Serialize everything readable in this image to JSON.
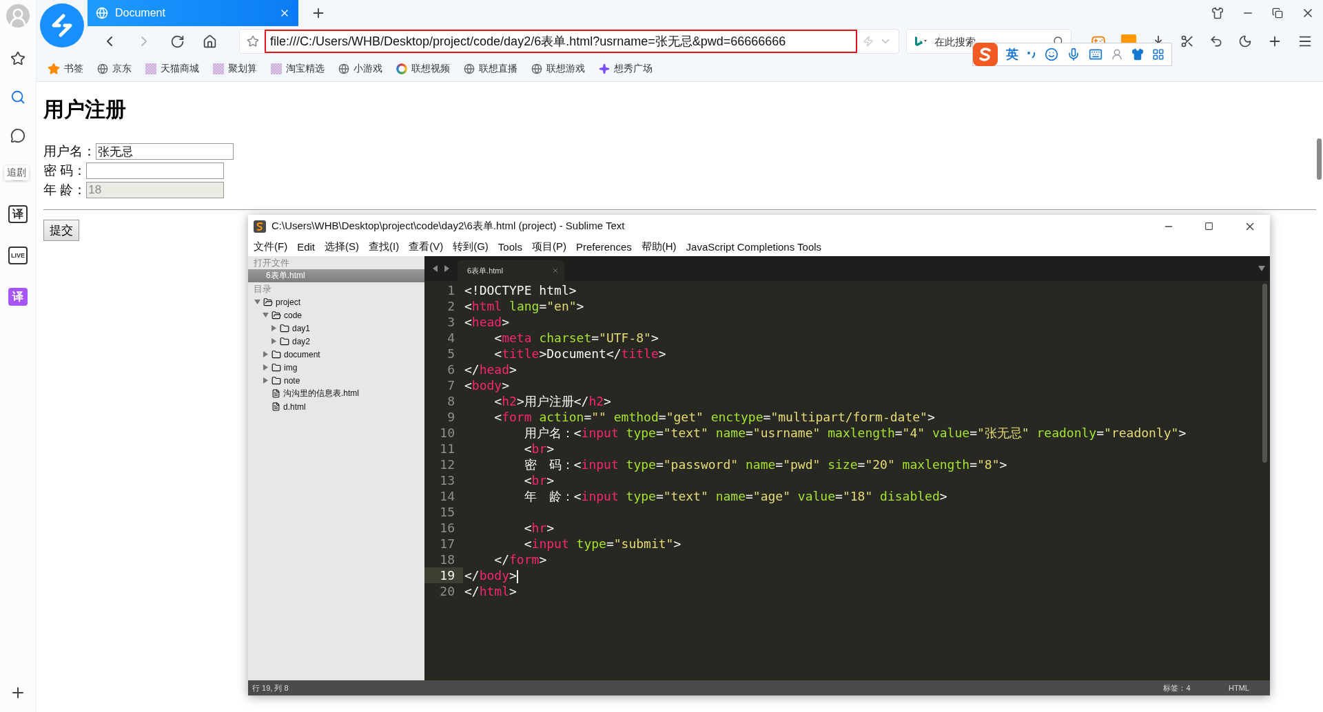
{
  "rail": {
    "tooltip": "追剧",
    "items": [
      {
        "kind": "star"
      },
      {
        "kind": "search"
      },
      {
        "kind": "chat"
      },
      {
        "kind": "video"
      },
      {
        "kind": "glyph",
        "text": "译"
      },
      {
        "kind": "glyph",
        "text": "LIVE"
      },
      {
        "kind": "filled",
        "text": "译"
      }
    ]
  },
  "browser": {
    "tab": {
      "title": "Document",
      "selected": true
    },
    "address": "file:///C:/Users/WHB/Desktop/project/code/day2/6表单.html?usrname=张无忌&pwd=66666666",
    "search_placeholder": "在此搜索",
    "ime_mode": "英",
    "bookmarks": [
      {
        "label": "书签",
        "kind": "star"
      },
      {
        "label": "京东",
        "kind": "globe"
      },
      {
        "label": "天猫商城",
        "kind": "pixel"
      },
      {
        "label": "聚划算",
        "kind": "pixel"
      },
      {
        "label": "淘宝精选",
        "kind": "pixel"
      },
      {
        "label": "小游戏",
        "kind": "globe"
      },
      {
        "label": "联想视频",
        "kind": "ring"
      },
      {
        "label": "联想直播",
        "kind": "globe"
      },
      {
        "label": "联想游戏",
        "kind": "globe"
      },
      {
        "label": "想秀广场",
        "kind": "sparkle"
      }
    ]
  },
  "page": {
    "heading": "用户注册",
    "fields": [
      {
        "label": "用户名：",
        "kind": "text",
        "value": "张无忌",
        "disabled": false
      },
      {
        "label": "密 码：",
        "kind": "password",
        "disabled": false
      },
      {
        "label": "年 龄：",
        "kind": "text",
        "value": "18",
        "disabled": true
      }
    ],
    "submit": "提交"
  },
  "editor": {
    "title": "C:\\Users\\WHB\\Desktop\\project\\code\\day2\\6表单.html (project) - Sublime Text",
    "menu": [
      "文件(F)",
      "Edit",
      "选择(S)",
      "查找(I)",
      "查看(V)",
      "转到(G)",
      "Tools",
      "项目(P)",
      "Preferences",
      "帮助(H)",
      "JavaScript Completions Tools"
    ],
    "open_files_heading": "打开文件",
    "open_files": [
      {
        "name": "6表单.html",
        "selected": true
      }
    ],
    "folders_heading": "目录",
    "tree": [
      {
        "name": "project",
        "kind": "folder",
        "expanded": true,
        "children": [
          {
            "name": "code",
            "kind": "folder",
            "expanded": true,
            "children": [
              {
                "name": "day1",
                "kind": "folder",
                "expanded": false
              },
              {
                "name": "day2",
                "kind": "folder",
                "expanded": false
              }
            ]
          },
          {
            "name": "document",
            "kind": "folder",
            "expanded": false
          },
          {
            "name": "img",
            "kind": "folder",
            "expanded": false
          },
          {
            "name": "note",
            "kind": "folder",
            "expanded": false
          },
          {
            "name": "沟沟里的信息表.html",
            "kind": "file"
          },
          {
            "name": "d.html",
            "kind": "file"
          }
        ]
      }
    ],
    "tabs": [
      {
        "label": "6表单.html",
        "selected": true
      }
    ],
    "lines": [
      {
        "number": "1",
        "current": false,
        "tokens": [
          {
            "kind": "plain",
            "text": "<!DOCTYPE html>"
          }
        ]
      },
      {
        "number": "2",
        "current": false,
        "tokens": [
          {
            "kind": "plain",
            "text": "<"
          },
          {
            "kind": "tag",
            "text": "html"
          },
          {
            "kind": "attr",
            "text": " lang"
          },
          {
            "kind": "plain",
            "text": "="
          },
          {
            "kind": "str",
            "text": "\"en\""
          },
          {
            "kind": "plain",
            "text": ">"
          }
        ]
      },
      {
        "number": "3",
        "current": false,
        "tokens": [
          {
            "kind": "plain",
            "text": "<"
          },
          {
            "kind": "tag",
            "text": "head"
          },
          {
            "kind": "plain",
            "text": ">"
          }
        ]
      },
      {
        "number": "4",
        "current": false,
        "tokens": [
          {
            "kind": "plain",
            "text": "    <"
          },
          {
            "kind": "tag",
            "text": "meta"
          },
          {
            "kind": "attr",
            "text": " charset"
          },
          {
            "kind": "plain",
            "text": "="
          },
          {
            "kind": "str",
            "text": "\"UTF-8\""
          },
          {
            "kind": "plain",
            "text": ">"
          }
        ]
      },
      {
        "number": "5",
        "current": false,
        "tokens": [
          {
            "kind": "plain",
            "text": "    <"
          },
          {
            "kind": "tag",
            "text": "title"
          },
          {
            "kind": "plain",
            "text": ">Document</"
          },
          {
            "kind": "tag",
            "text": "title"
          },
          {
            "kind": "plain",
            "text": ">"
          }
        ]
      },
      {
        "number": "6",
        "current": false,
        "tokens": [
          {
            "kind": "plain",
            "text": "</"
          },
          {
            "kind": "tag",
            "text": "head"
          },
          {
            "kind": "plain",
            "text": ">"
          }
        ]
      },
      {
        "number": "7",
        "current": false,
        "tokens": [
          {
            "kind": "plain",
            "text": "<"
          },
          {
            "kind": "tag",
            "text": "body"
          },
          {
            "kind": "plain",
            "text": ">"
          }
        ]
      },
      {
        "number": "8",
        "current": false,
        "tokens": [
          {
            "kind": "plain",
            "text": "    <"
          },
          {
            "kind": "tag",
            "text": "h2"
          },
          {
            "kind": "plain",
            "text": ">用户注册</"
          },
          {
            "kind": "tag",
            "text": "h2"
          },
          {
            "kind": "plain",
            "text": ">"
          }
        ]
      },
      {
        "number": "9",
        "current": false,
        "tokens": [
          {
            "kind": "plain",
            "text": "    <"
          },
          {
            "kind": "tag",
            "text": "form"
          },
          {
            "kind": "attr",
            "text": " action"
          },
          {
            "kind": "plain",
            "text": "="
          },
          {
            "kind": "str",
            "text": "\"\""
          },
          {
            "kind": "attr",
            "text": " emthod"
          },
          {
            "kind": "plain",
            "text": "="
          },
          {
            "kind": "str",
            "text": "\"get\""
          },
          {
            "kind": "attr",
            "text": " enctype"
          },
          {
            "kind": "plain",
            "text": "="
          },
          {
            "kind": "str",
            "text": "\"multipart/form-date\""
          },
          {
            "kind": "plain",
            "text": ">"
          }
        ]
      },
      {
        "number": "10",
        "current": false,
        "tokens": [
          {
            "kind": "plain",
            "text": "        用户名：<"
          },
          {
            "kind": "tag",
            "text": "input"
          },
          {
            "kind": "attr",
            "text": " type"
          },
          {
            "kind": "plain",
            "text": "="
          },
          {
            "kind": "str",
            "text": "\"text\""
          },
          {
            "kind": "attr",
            "text": " name"
          },
          {
            "kind": "plain",
            "text": "="
          },
          {
            "kind": "str",
            "text": "\"usrname\""
          },
          {
            "kind": "attr",
            "text": " maxlength"
          },
          {
            "kind": "plain",
            "text": "="
          },
          {
            "kind": "str",
            "text": "\"4\""
          },
          {
            "kind": "attr",
            "text": " value"
          },
          {
            "kind": "plain",
            "text": "="
          },
          {
            "kind": "str",
            "text": "\"张无忌\""
          },
          {
            "kind": "attr",
            "text": " readonly"
          },
          {
            "kind": "plain",
            "text": "="
          },
          {
            "kind": "str",
            "text": "\"readonly\""
          },
          {
            "kind": "plain",
            "text": ">"
          }
        ]
      },
      {
        "number": "11",
        "current": false,
        "tokens": [
          {
            "kind": "plain",
            "text": "        <"
          },
          {
            "kind": "tag",
            "text": "br"
          },
          {
            "kind": "plain",
            "text": ">"
          }
        ]
      },
      {
        "number": "12",
        "current": false,
        "tokens": [
          {
            "kind": "plain",
            "text": "        密　码：<"
          },
          {
            "kind": "tag",
            "text": "input"
          },
          {
            "kind": "attr",
            "text": " type"
          },
          {
            "kind": "plain",
            "text": "="
          },
          {
            "kind": "str",
            "text": "\"password\""
          },
          {
            "kind": "attr",
            "text": " name"
          },
          {
            "kind": "plain",
            "text": "="
          },
          {
            "kind": "str",
            "text": "\"pwd\""
          },
          {
            "kind": "attr",
            "text": " size"
          },
          {
            "kind": "plain",
            "text": "="
          },
          {
            "kind": "str",
            "text": "\"20\""
          },
          {
            "kind": "attr",
            "text": " maxlength"
          },
          {
            "kind": "plain",
            "text": "="
          },
          {
            "kind": "str",
            "text": "\"8\""
          },
          {
            "kind": "plain",
            "text": ">"
          }
        ]
      },
      {
        "number": "13",
        "current": false,
        "tokens": [
          {
            "kind": "plain",
            "text": "        <"
          },
          {
            "kind": "tag",
            "text": "br"
          },
          {
            "kind": "plain",
            "text": ">"
          }
        ]
      },
      {
        "number": "14",
        "current": false,
        "tokens": [
          {
            "kind": "plain",
            "text": "        年　龄：<"
          },
          {
            "kind": "tag",
            "text": "input"
          },
          {
            "kind": "attr",
            "text": " type"
          },
          {
            "kind": "plain",
            "text": "="
          },
          {
            "kind": "str",
            "text": "\"text\""
          },
          {
            "kind": "attr",
            "text": " name"
          },
          {
            "kind": "plain",
            "text": "="
          },
          {
            "kind": "str",
            "text": "\"age\""
          },
          {
            "kind": "attr",
            "text": " value"
          },
          {
            "kind": "plain",
            "text": "="
          },
          {
            "kind": "str",
            "text": "\"18\""
          },
          {
            "kind": "attr",
            "text": " disabled"
          },
          {
            "kind": "plain",
            "text": ">"
          }
        ]
      },
      {
        "number": "15",
        "current": false
      },
      {
        "number": "16",
        "current": false,
        "tokens": [
          {
            "kind": "plain",
            "text": "        <"
          },
          {
            "kind": "tag",
            "text": "hr"
          },
          {
            "kind": "plain",
            "text": ">"
          }
        ]
      },
      {
        "number": "17",
        "current": false,
        "tokens": [
          {
            "kind": "plain",
            "text": "        <"
          },
          {
            "kind": "tag",
            "text": "input"
          },
          {
            "kind": "attr",
            "text": " type"
          },
          {
            "kind": "plain",
            "text": "="
          },
          {
            "kind": "str",
            "text": "\"submit\""
          },
          {
            "kind": "plain",
            "text": ">"
          }
        ]
      },
      {
        "number": "18",
        "current": false,
        "tokens": [
          {
            "kind": "plain",
            "text": "    </"
          },
          {
            "kind": "tag",
            "text": "form"
          },
          {
            "kind": "plain",
            "text": ">"
          }
        ]
      },
      {
        "number": "19",
        "current": true,
        "tokens": [
          {
            "kind": "plain",
            "text": "</"
          },
          {
            "kind": "tag",
            "text": "body"
          },
          {
            "kind": "plain",
            "text": ">"
          }
        ]
      },
      {
        "number": "20",
        "current": false,
        "tokens": [
          {
            "kind": "plain",
            "text": "</"
          },
          {
            "kind": "tag",
            "text": "html"
          },
          {
            "kind": "plain",
            "text": ">"
          }
        ]
      }
    ],
    "status": {
      "position": "行 19, 列 8",
      "tab_size": "标签：4",
      "syntax": "HTML"
    }
  }
}
